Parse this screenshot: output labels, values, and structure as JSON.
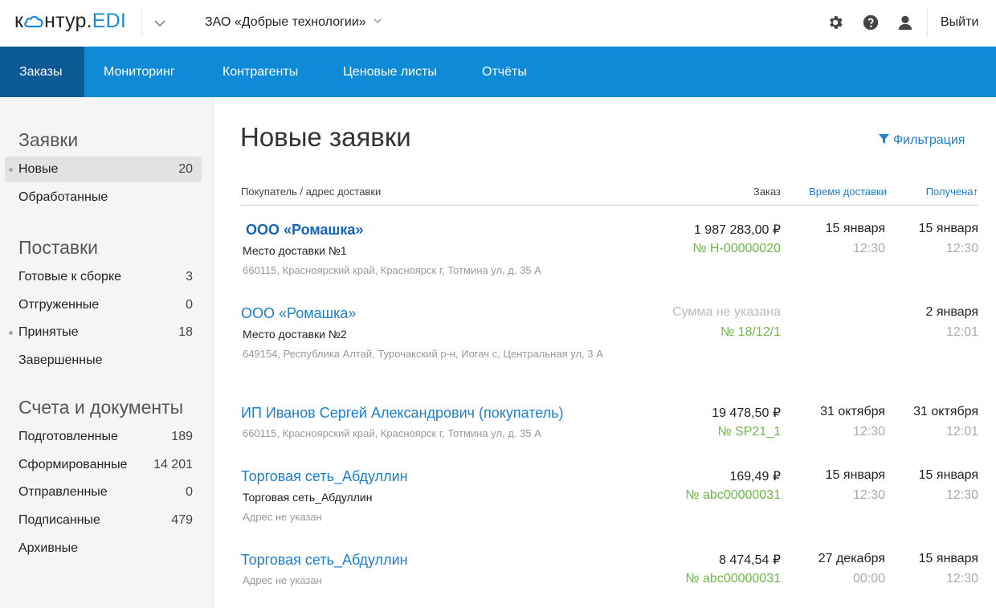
{
  "header": {
    "logo_main": "к",
    "logo_rest": "нтур.",
    "logo_edi": "EDI",
    "org": "ЗАО «Добрые технологии»",
    "logout": "Выйти"
  },
  "nav": {
    "tabs": [
      {
        "label": "Заказы",
        "active": true
      },
      {
        "label": "Мониторинг"
      },
      {
        "label": "Контрагенты"
      },
      {
        "label": "Ценовые листы"
      },
      {
        "label": "Отчёты"
      }
    ]
  },
  "sidebar": {
    "sections": [
      {
        "title": "Заявки",
        "items": [
          {
            "label": "Новые",
            "count": "20",
            "active": true
          },
          {
            "label": "Обработанные",
            "count": ""
          }
        ]
      },
      {
        "title": "Поставки",
        "items": [
          {
            "label": "Готовые к сборке",
            "count": "3"
          },
          {
            "label": "Отгруженные",
            "count": "0"
          },
          {
            "label": "Принятые",
            "count": "18"
          },
          {
            "label": "Завершенные",
            "count": ""
          }
        ]
      },
      {
        "title": "Счета и документы",
        "items": [
          {
            "label": "Подготовленные",
            "count": "189"
          },
          {
            "label": "Сформированные",
            "count": "14 201"
          },
          {
            "label": "Отправленные",
            "count": "0"
          },
          {
            "label": "Подписанные",
            "count": "479"
          },
          {
            "label": "Архивные",
            "count": ""
          }
        ]
      }
    ]
  },
  "main": {
    "title": "Новые заявки",
    "filter_label": "Фильтрация",
    "columns": {
      "buyer": "Покупатель / адрес доставки",
      "order": "Заказ",
      "delivery_time": "Время доставки",
      "received": "Получена",
      "sort_arrow": "↑"
    },
    "rows": [
      {
        "buyer": "ООО «Ромашка»",
        "place": "Место доставки №1",
        "address": "660115, Красноярский край, Красноярск г, Тотмина ул, д. 35 А",
        "sum": "1 987 283,00 ₽",
        "order_no": "№ Н-00000020",
        "delivery_date": "15 января",
        "delivery_time": "12:30",
        "received_date": "15 января",
        "received_time": "12:30"
      },
      {
        "buyer": "ООО «Ромашка»",
        "place": "Место доставки №2",
        "address": "649154, Республика Алтай, Турочакский р-н, Иогач с, Центральная ул, 3 А",
        "sum": "Сумма не указана",
        "order_no": "№ 18/12/1",
        "delivery_date": "",
        "delivery_time": "",
        "received_date": "2 января",
        "received_time": "12:01"
      },
      {
        "buyer": "ИП Иванов Сергей Александрович (покупатель)",
        "place": "",
        "address": "660115, Красноярский край, Красноярск г, Тотмина ул, д. 35 А",
        "sum": "19 478,50 ₽",
        "order_no": "№ SP21_1",
        "delivery_date": "31 октября",
        "delivery_time": "12:30",
        "received_date": "31 октября",
        "received_time": "12:01"
      },
      {
        "buyer": "Торговая сеть_Абдуллин",
        "place": "Торговая сеть_Абдуллин",
        "address": "Адрес не указан",
        "sum": "169,49 ₽",
        "order_no": "№ abc00000031",
        "delivery_date": "15 января",
        "delivery_time": "12:30",
        "received_date": "15 января",
        "received_time": "12:30"
      },
      {
        "buyer": "Торговая сеть_Абдуллин",
        "place": "",
        "address": "Адрес не указан",
        "sum": "8 474,54 ₽",
        "order_no": "№ abc00000031",
        "delivery_date": "27 декабря",
        "delivery_time": "00:00",
        "received_date": "15 января",
        "received_time": "12:30"
      }
    ]
  },
  "colors": {
    "nav_bg": "#0e8ad6",
    "nav_active": "#0b5a95",
    "link": "#1a7fd0",
    "order_no": "#6cb848"
  }
}
